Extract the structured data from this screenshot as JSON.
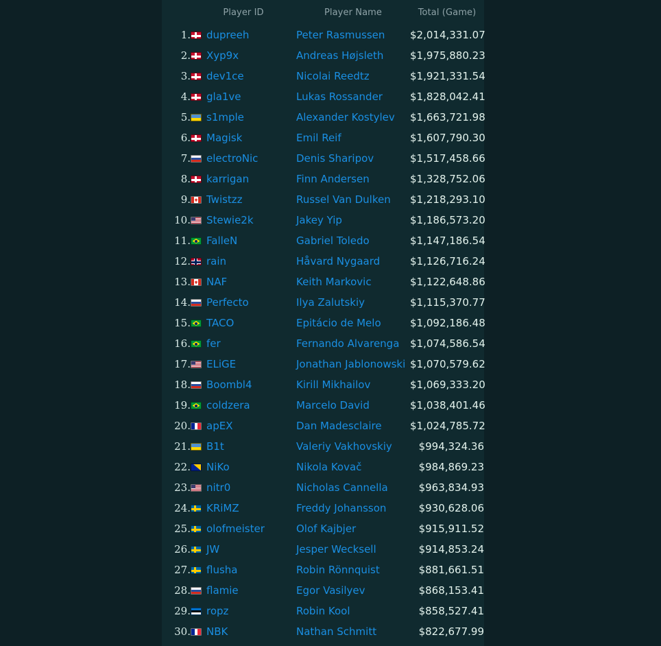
{
  "table": {
    "headers": {
      "rank": "",
      "player_id": "Player ID",
      "player_name": "Player Name",
      "total": "Total (Game)"
    },
    "colors": {
      "background": "#0d2025",
      "band": "#102a2f",
      "link": "#1a8fe3",
      "header_text": "#8fa3a8",
      "rank_text": "#d7e9e6",
      "total_text": "#e3f2ec"
    },
    "rows": [
      {
        "rank": "1.",
        "flag": "dk",
        "flag_name": "denmark-flag-icon",
        "player_id": "dupreeh",
        "player_name": "Peter Rasmussen",
        "total": "$2,014,331.07"
      },
      {
        "rank": "2.",
        "flag": "dk",
        "flag_name": "denmark-flag-icon",
        "player_id": "Xyp9x",
        "player_name": "Andreas Højsleth",
        "total": "$1,975,880.23"
      },
      {
        "rank": "3.",
        "flag": "dk",
        "flag_name": "denmark-flag-icon",
        "player_id": "dev1ce",
        "player_name": "Nicolai Reedtz",
        "total": "$1,921,331.54"
      },
      {
        "rank": "4.",
        "flag": "dk",
        "flag_name": "denmark-flag-icon",
        "player_id": "gla1ve",
        "player_name": "Lukas Rossander",
        "total": "$1,828,042.41"
      },
      {
        "rank": "5.",
        "flag": "ua",
        "flag_name": "ukraine-flag-icon",
        "player_id": "s1mple",
        "player_name": "Alexander Kostylev",
        "total": "$1,663,721.98"
      },
      {
        "rank": "6.",
        "flag": "dk",
        "flag_name": "denmark-flag-icon",
        "player_id": "Magisk",
        "player_name": "Emil Reif",
        "total": "$1,607,790.30"
      },
      {
        "rank": "7.",
        "flag": "ru",
        "flag_name": "russia-flag-icon",
        "player_id": "electroNic",
        "player_name": "Denis Sharipov",
        "total": "$1,517,458.66"
      },
      {
        "rank": "8.",
        "flag": "dk",
        "flag_name": "denmark-flag-icon",
        "player_id": "karrigan",
        "player_name": "Finn Andersen",
        "total": "$1,328,752.06"
      },
      {
        "rank": "9.",
        "flag": "ca",
        "flag_name": "canada-flag-icon",
        "player_id": "Twistzz",
        "player_name": "Russel Van Dulken",
        "total": "$1,218,293.10"
      },
      {
        "rank": "10.",
        "flag": "us",
        "flag_name": "usa-flag-icon",
        "player_id": "Stewie2k",
        "player_name": "Jakey Yip",
        "total": "$1,186,573.20"
      },
      {
        "rank": "11.",
        "flag": "br",
        "flag_name": "brazil-flag-icon",
        "player_id": "FalleN",
        "player_name": "Gabriel Toledo",
        "total": "$1,147,186.54"
      },
      {
        "rank": "12.",
        "flag": "no",
        "flag_name": "norway-flag-icon",
        "player_id": "rain",
        "player_name": "Håvard Nygaard",
        "total": "$1,126,716.24"
      },
      {
        "rank": "13.",
        "flag": "ca",
        "flag_name": "canada-flag-icon",
        "player_id": "NAF",
        "player_name": "Keith Markovic",
        "total": "$1,122,648.86"
      },
      {
        "rank": "14.",
        "flag": "ru",
        "flag_name": "russia-flag-icon",
        "player_id": "Perfecto",
        "player_name": "Ilya Zalutskiy",
        "total": "$1,115,370.77"
      },
      {
        "rank": "15.",
        "flag": "br",
        "flag_name": "brazil-flag-icon",
        "player_id": "TACO",
        "player_name": "Epitácio de Melo",
        "total": "$1,092,186.48"
      },
      {
        "rank": "16.",
        "flag": "br",
        "flag_name": "brazil-flag-icon",
        "player_id": "fer",
        "player_name": "Fernando Alvarenga",
        "total": "$1,074,586.54"
      },
      {
        "rank": "17.",
        "flag": "us",
        "flag_name": "usa-flag-icon",
        "player_id": "ELiGE",
        "player_name": "Jonathan Jablonowski",
        "total": "$1,070,579.62"
      },
      {
        "rank": "18.",
        "flag": "ru",
        "flag_name": "russia-flag-icon",
        "player_id": "Boombl4",
        "player_name": "Kirill Mikhailov",
        "total": "$1,069,333.20"
      },
      {
        "rank": "19.",
        "flag": "br",
        "flag_name": "brazil-flag-icon",
        "player_id": "coldzera",
        "player_name": "Marcelo David",
        "total": "$1,038,401.46"
      },
      {
        "rank": "20.",
        "flag": "fr",
        "flag_name": "france-flag-icon",
        "player_id": "apEX",
        "player_name": "Dan Madesclaire",
        "total": "$1,024,785.72"
      },
      {
        "rank": "21.",
        "flag": "ua",
        "flag_name": "ukraine-flag-icon",
        "player_id": "B1t",
        "player_name": "Valeriy Vakhovskiy",
        "total": "$994,324.36"
      },
      {
        "rank": "22.",
        "flag": "ba",
        "flag_name": "bosnia-flag-icon",
        "player_id": "NiKo",
        "player_name": "Nikola Kovač",
        "total": "$984,869.23"
      },
      {
        "rank": "23.",
        "flag": "us",
        "flag_name": "usa-flag-icon",
        "player_id": "nitr0",
        "player_name": "Nicholas Cannella",
        "total": "$963,834.93"
      },
      {
        "rank": "24.",
        "flag": "se",
        "flag_name": "sweden-flag-icon",
        "player_id": "KRiMZ",
        "player_name": "Freddy Johansson",
        "total": "$930,628.06"
      },
      {
        "rank": "25.",
        "flag": "se",
        "flag_name": "sweden-flag-icon",
        "player_id": "olofmeister",
        "player_name": "Olof Kajbjer",
        "total": "$915,911.52"
      },
      {
        "rank": "26.",
        "flag": "se",
        "flag_name": "sweden-flag-icon",
        "player_id": "JW",
        "player_name": "Jesper Wecksell",
        "total": "$914,853.24"
      },
      {
        "rank": "27.",
        "flag": "se",
        "flag_name": "sweden-flag-icon",
        "player_id": "flusha",
        "player_name": "Robin Rönnquist",
        "total": "$881,661.51"
      },
      {
        "rank": "28.",
        "flag": "ru",
        "flag_name": "russia-flag-icon",
        "player_id": "flamie",
        "player_name": "Egor Vasilyev",
        "total": "$868,153.41"
      },
      {
        "rank": "29.",
        "flag": "ee",
        "flag_name": "estonia-flag-icon",
        "player_id": "ropz",
        "player_name": "Robin Kool",
        "total": "$858,527.41"
      },
      {
        "rank": "30.",
        "flag": "fr",
        "flag_name": "france-flag-icon",
        "player_id": "NBK",
        "player_name": "Nathan Schmitt",
        "total": "$822,677.99"
      }
    ]
  }
}
